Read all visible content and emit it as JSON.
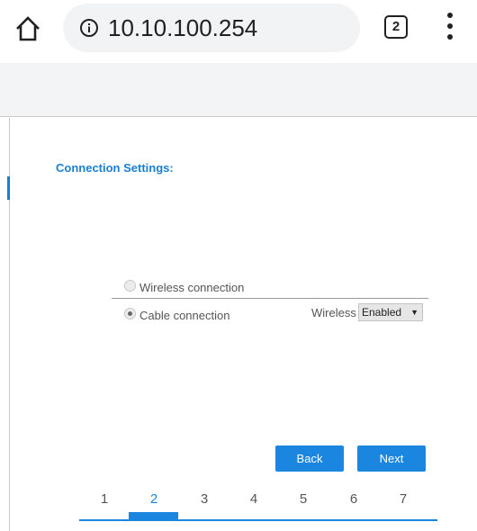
{
  "browser": {
    "url": "10.10.100.254",
    "tab_count": "2",
    "icons": [
      "home-icon",
      "info-icon",
      "tab-switcher-icon",
      "more-vert-icon"
    ]
  },
  "page": {
    "section_title": "Connection Settings:",
    "options": [
      {
        "label": "Wireless connection",
        "selected": false
      },
      {
        "label": "Cable connection",
        "selected": true
      }
    ],
    "wireless_label": "Wireless",
    "wireless_select": {
      "value": "Enabled"
    },
    "back_label": "Back",
    "next_label": "Next",
    "steps": [
      "1",
      "2",
      "3",
      "4",
      "5",
      "6",
      "7"
    ],
    "current_step": "2"
  },
  "colors": {
    "accent": "#1a86e0",
    "title": "#1a7fd4",
    "text": "#555555",
    "band": "#f3f4f6"
  }
}
